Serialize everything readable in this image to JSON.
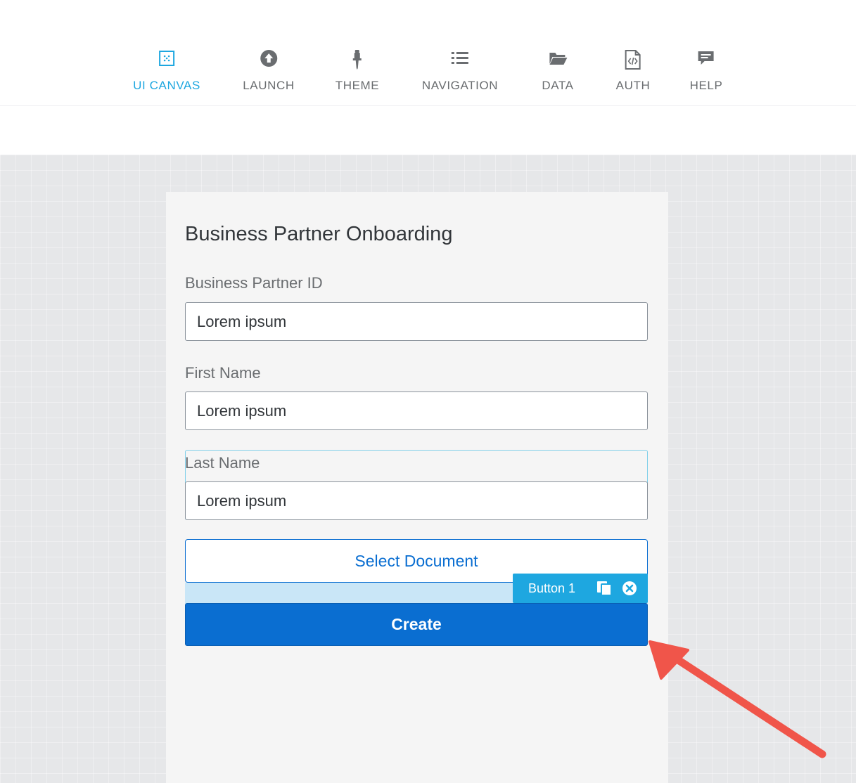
{
  "toolbar": {
    "items": [
      {
        "label": "UI CANVAS",
        "icon": "canvas-icon",
        "active": true
      },
      {
        "label": "LAUNCH",
        "icon": "launch-icon",
        "active": false
      },
      {
        "label": "THEME",
        "icon": "theme-icon",
        "active": false
      },
      {
        "label": "NAVIGATION",
        "icon": "list-icon",
        "active": false
      },
      {
        "label": "DATA",
        "icon": "folder-icon",
        "active": false
      },
      {
        "label": "AUTH",
        "icon": "code-file-icon",
        "active": false
      },
      {
        "label": "HELP",
        "icon": "chat-icon",
        "active": false
      }
    ]
  },
  "form": {
    "title": "Business Partner Onboarding",
    "fields": [
      {
        "label": "Business Partner ID",
        "value": "Lorem ipsum"
      },
      {
        "label": "First Name",
        "value": "Lorem ipsum"
      },
      {
        "label": "Last Name",
        "value": "Lorem ipsum"
      }
    ],
    "select_document_label": "Select Document",
    "create_label": "Create"
  },
  "selection": {
    "tag_label": "Button 1",
    "tag_icons": [
      "copy-icon",
      "close-icon"
    ]
  },
  "colors": {
    "accent": "#1ea7e0",
    "primary_button": "#0a6ed1",
    "annotation_arrow": "#f0554a"
  }
}
